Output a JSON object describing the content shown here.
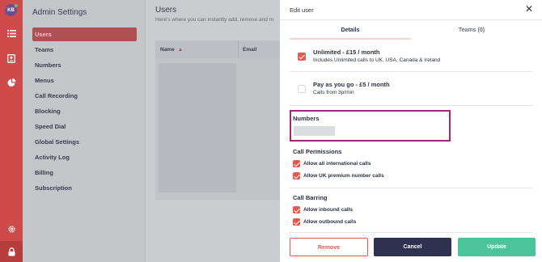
{
  "user": {
    "initials": "KB"
  },
  "nav": {
    "title": "Admin Settings",
    "items": [
      {
        "label": "Users",
        "active": true
      },
      {
        "label": "Teams"
      },
      {
        "label": "Numbers"
      },
      {
        "label": "Menus"
      },
      {
        "label": "Call Recording"
      },
      {
        "label": "Blocking"
      },
      {
        "label": "Speed Dial"
      },
      {
        "label": "Global Settings"
      },
      {
        "label": "Activity Log"
      },
      {
        "label": "Billing"
      },
      {
        "label": "Subscription"
      }
    ]
  },
  "main": {
    "title": "Users",
    "subtitle": "Here's where you can instantly add, remove and m",
    "columns": [
      "Name",
      "Email"
    ]
  },
  "panel": {
    "title": "Edit user",
    "tabs": [
      "Details",
      "Teams (0)"
    ],
    "plans": [
      {
        "name": "Unlimited - £15 / month",
        "desc": "Includes Unlimited calls to UK, USA, Canada & Ireland",
        "checked": true
      },
      {
        "name": "Pay as you go - £5 / month",
        "desc": "Calls from 3p/min",
        "checked": false
      }
    ],
    "numbers_label": "Numbers",
    "call_permissions": {
      "title": "Call Permissions",
      "options": [
        "Allow all international calls",
        "Allow UK premium number calls"
      ]
    },
    "call_barring": {
      "title": "Call Barring",
      "options": [
        "Allow inbound calls",
        "Allow outbound calls"
      ]
    },
    "buttons": {
      "remove": "Remove",
      "cancel": "Cancel",
      "update": "Update"
    }
  },
  "colors": {
    "brand_red": "#cf4a4a",
    "checkbox": "#e8584f",
    "cancel": "#2e3150",
    "update": "#4cc39a",
    "highlight": "#a6247a"
  }
}
